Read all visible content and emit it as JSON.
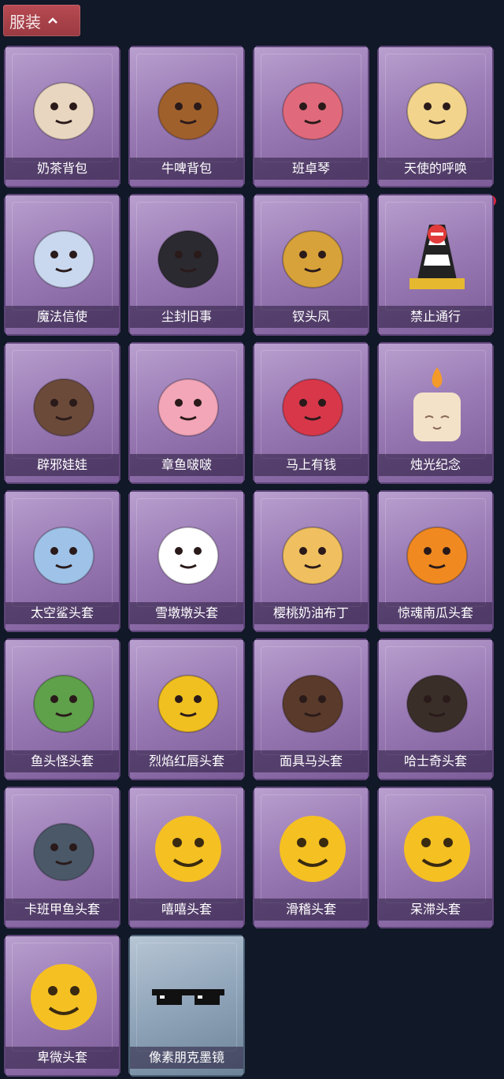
{
  "header": {
    "title": "服装"
  },
  "items": [
    {
      "label": "奶茶背包",
      "icon": "milk-tea-backpack-icon",
      "color": "#e8d6c0"
    },
    {
      "label": "牛啤背包",
      "icon": "beer-cow-backpack-icon",
      "color": "#a0602c"
    },
    {
      "label": "班卓琴",
      "icon": "banjo-beaver-icon",
      "color": "#e06a7c"
    },
    {
      "label": "天使的呼唤",
      "icon": "angel-icon",
      "color": "#f2d48c"
    },
    {
      "label": "魔法信使",
      "icon": "magic-elephant-icon",
      "color": "#c9d8ef"
    },
    {
      "label": "尘封旧事",
      "icon": "dusty-doll-icon",
      "color": "#2b2a30"
    },
    {
      "label": "钗头凤",
      "icon": "phoenix-crown-icon",
      "color": "#d8a23a"
    },
    {
      "label": "禁止通行",
      "icon": "traffic-cone-icon",
      "color": "#e6b830"
    },
    {
      "label": "辟邪娃娃",
      "icon": "doll-head-icon",
      "color": "#6b4a3a"
    },
    {
      "label": "章鱼啵啵",
      "icon": "octopus-icon",
      "color": "#f3a6b8"
    },
    {
      "label": "马上有钱",
      "icon": "red-horse-icon",
      "color": "#d8374a"
    },
    {
      "label": "烛光纪念",
      "icon": "candle-icon",
      "color": "#f4e2c8"
    },
    {
      "label": "太空鲨头套",
      "icon": "shark-head-icon",
      "color": "#9fc3e8"
    },
    {
      "label": "雪墩墩头套",
      "icon": "snowman-head-icon",
      "color": "#ffffff"
    },
    {
      "label": "樱桃奶油布丁",
      "icon": "pudding-icon",
      "color": "#f0c060"
    },
    {
      "label": "惊魂南瓜头套",
      "icon": "pumpkin-icon",
      "color": "#f08a20"
    },
    {
      "label": "鱼头怪头套",
      "icon": "fish-head-icon",
      "color": "#5fa04a"
    },
    {
      "label": "烈焰红唇头套",
      "icon": "yellow-mask-icon",
      "color": "#f0c020"
    },
    {
      "label": "面具马头套",
      "icon": "horse-mask-icon",
      "color": "#5a3a2a"
    },
    {
      "label": "哈士奇头套",
      "icon": "husky-mask-icon",
      "color": "#3a2e28"
    },
    {
      "label": "卡班甲鱼头套",
      "icon": "turtle-head-icon",
      "color": "#4a5868"
    },
    {
      "label": "嘻嘻头套",
      "icon": "grin-emoji-icon",
      "color": "#f5c022"
    },
    {
      "label": "滑稽头套",
      "icon": "smirk-emoji-icon",
      "color": "#f5c022"
    },
    {
      "label": "呆滞头套",
      "icon": "stare-emoji-icon",
      "color": "#f5c022"
    },
    {
      "label": "卑微头套",
      "icon": "humble-emoji-icon",
      "color": "#f5c022"
    },
    {
      "label": "像素朋克墨镜",
      "icon": "pixel-sunglasses-icon",
      "color": "#111111"
    }
  ]
}
